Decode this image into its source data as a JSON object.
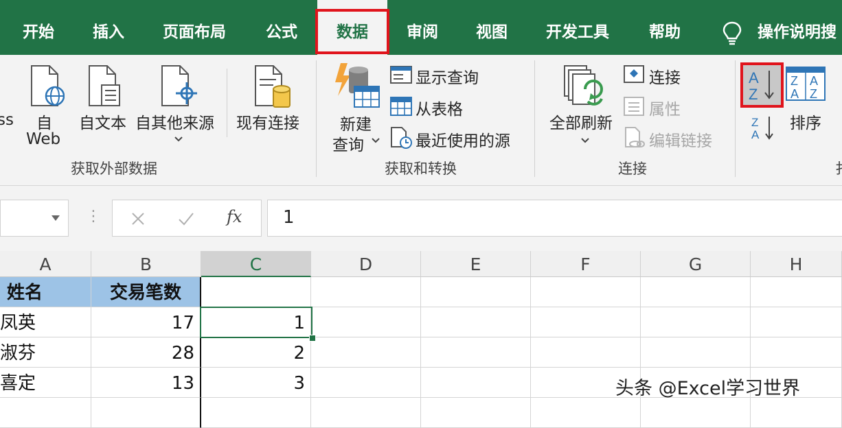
{
  "tabs": [
    "开始",
    "插入",
    "页面布局",
    "公式",
    "数据",
    "审阅",
    "视图",
    "开发工具",
    "帮助"
  ],
  "tell_me": "操作说明搜",
  "colors": {
    "excel_green": "#217346",
    "highlight_red": "#e0141c",
    "header_blue": "#9dc3e6"
  },
  "ribbon": {
    "get_external": {
      "cut_label": "ss",
      "web_line1": "自",
      "web_line2": "Web",
      "from_text": "自文本",
      "from_other": "自其他来源",
      "existing": "现有连接",
      "group_label": "获取外部数据"
    },
    "get_transform": {
      "new_query_line1": "新建",
      "new_query_line2": "查询",
      "show_queries": "显示查询",
      "from_table": "从表格",
      "recent_sources": "最近使用的源",
      "group_label": "获取和转换"
    },
    "connections": {
      "refresh_all": "全部刷新",
      "connections": "连接",
      "properties": "属性",
      "edit_links": "编辑链接",
      "group_label": "连接"
    },
    "sort": {
      "sort_label": "排序",
      "group_label_cut": "扌"
    }
  },
  "formula_bar": {
    "fx": "fx",
    "value": "1"
  },
  "columns": [
    "A",
    "B",
    "C",
    "D",
    "E",
    "F",
    "G",
    "H"
  ],
  "table": {
    "headers": [
      "姓名",
      "交易笔数"
    ],
    "rows": [
      {
        "name": "凤英",
        "count": "17",
        "c": "1"
      },
      {
        "name": "淑芬",
        "count": "28",
        "c": "2"
      },
      {
        "name": "喜定",
        "count": "13",
        "c": "3"
      },
      {
        "name": "",
        "count": "",
        "c": ""
      }
    ]
  },
  "watermark": "头条 @Excel学习世界"
}
